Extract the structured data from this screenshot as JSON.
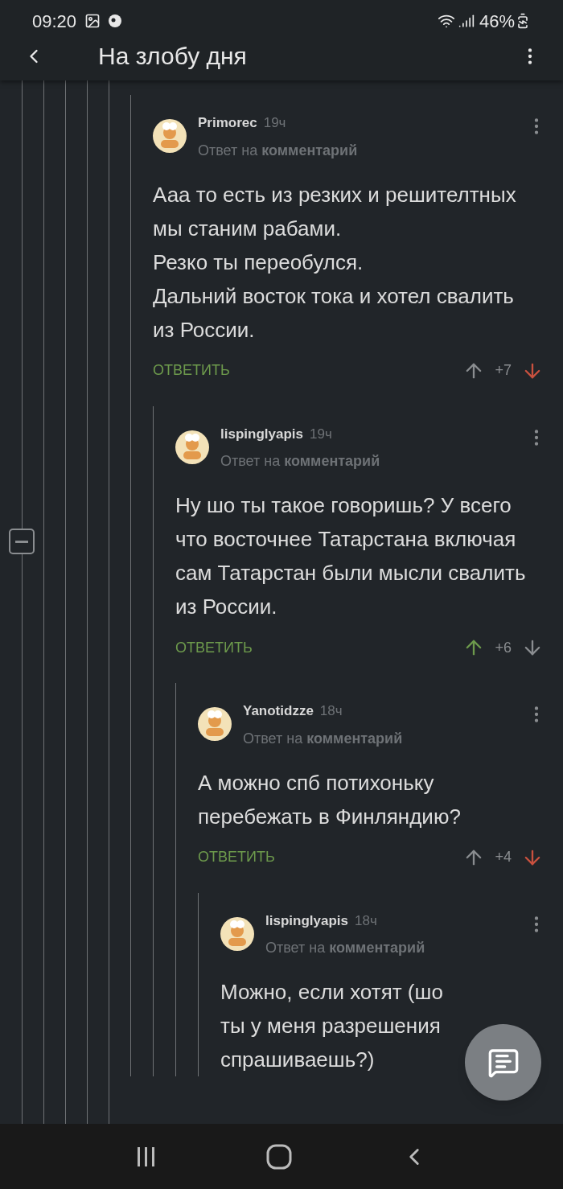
{
  "status_bar": {
    "time": "09:20",
    "battery": "46%"
  },
  "header": {
    "title": "На злобу дня"
  },
  "comments": [
    {
      "author": "Primorec",
      "time": "19ч",
      "reply_to": "Ответ на **комментарий**",
      "body": [
        "Ааа то есть из резких и решителтных мы станим рабами.",
        "Резко ты переобулся.",
        "Дальний восток тока и хотел свалить из России."
      ],
      "reply_label": "ОТВЕТИТЬ",
      "rating": "+7",
      "upvoted": false,
      "downvoted": true,
      "children": [
        {
          "author": "lispinglyapis",
          "time": "19ч",
          "reply_to": "Ответ на **комментарий**",
          "body": [
            "Ну шо ты такое говоришь? У всего что восточнее Татарстана включая сам Татарстан были мысли свалить из России."
          ],
          "reply_label": "ОТВЕТИТЬ",
          "rating": "+6",
          "upvoted": true,
          "downvoted": false,
          "children": [
            {
              "author": "Yanotidzze",
              "time": "18ч",
              "reply_to": "Ответ на **комментарий**",
              "body": [
                "А можно спб потихоньку перебежать в Финляндию?"
              ],
              "reply_label": "ОТВЕТИТЬ",
              "rating": "+4",
              "upvoted": false,
              "downvoted": true,
              "children": [
                {
                  "author": "lispinglyapis",
                  "time": "18ч",
                  "reply_to": "Ответ на **комментарий**",
                  "body": [
                    "Можно, если хотят (шо ты у меня разрешения спрашиваешь?)"
                  ]
                }
              ]
            }
          ]
        }
      ]
    }
  ]
}
